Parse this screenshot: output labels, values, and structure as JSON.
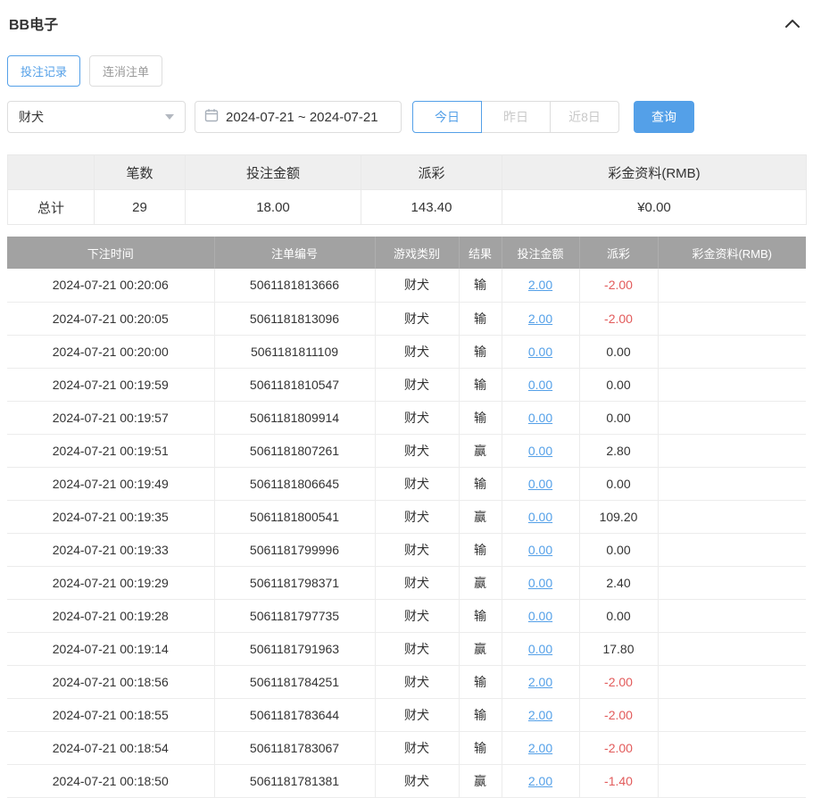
{
  "header": {
    "title": "BB电子",
    "collapse_icon": "chevron-up"
  },
  "tabs": [
    {
      "label": "投注记录",
      "active": true
    },
    {
      "label": "连消注单",
      "active": false
    }
  ],
  "filters": {
    "game_select_value": "财犬",
    "date_range_value": "2024-07-21 ~ 2024-07-21",
    "quick_buttons": [
      {
        "label": "今日",
        "active": true
      },
      {
        "label": "昨日",
        "active": false
      },
      {
        "label": "近8日",
        "active": false
      }
    ],
    "search_label": "查询"
  },
  "summary": {
    "row_label": "总计",
    "columns": [
      "笔数",
      "投注金额",
      "派彩",
      "彩金资料(RMB)"
    ],
    "values": [
      "29",
      "18.00",
      "143.40",
      "¥0.00"
    ]
  },
  "table": {
    "columns": [
      "下注时间",
      "注单编号",
      "游戏类别",
      "结果",
      "投注金额",
      "派彩",
      "彩金资料(RMB)"
    ],
    "rows": [
      {
        "time": "2024-07-21 00:20:06",
        "order_id": "5061181813666",
        "game": "财犬",
        "result": "输",
        "bet": "2.00",
        "payout": "-2.00",
        "bonus": ""
      },
      {
        "time": "2024-07-21 00:20:05",
        "order_id": "5061181813096",
        "game": "财犬",
        "result": "输",
        "bet": "2.00",
        "payout": "-2.00",
        "bonus": ""
      },
      {
        "time": "2024-07-21 00:20:00",
        "order_id": "5061181811109",
        "game": "财犬",
        "result": "输",
        "bet": "0.00",
        "payout": "0.00",
        "bonus": ""
      },
      {
        "time": "2024-07-21 00:19:59",
        "order_id": "5061181810547",
        "game": "财犬",
        "result": "输",
        "bet": "0.00",
        "payout": "0.00",
        "bonus": ""
      },
      {
        "time": "2024-07-21 00:19:57",
        "order_id": "5061181809914",
        "game": "财犬",
        "result": "输",
        "bet": "0.00",
        "payout": "0.00",
        "bonus": ""
      },
      {
        "time": "2024-07-21 00:19:51",
        "order_id": "5061181807261",
        "game": "财犬",
        "result": "赢",
        "bet": "0.00",
        "payout": "2.80",
        "bonus": ""
      },
      {
        "time": "2024-07-21 00:19:49",
        "order_id": "5061181806645",
        "game": "财犬",
        "result": "输",
        "bet": "0.00",
        "payout": "0.00",
        "bonus": ""
      },
      {
        "time": "2024-07-21 00:19:35",
        "order_id": "5061181800541",
        "game": "财犬",
        "result": "赢",
        "bet": "0.00",
        "payout": "109.20",
        "bonus": ""
      },
      {
        "time": "2024-07-21 00:19:33",
        "order_id": "5061181799996",
        "game": "财犬",
        "result": "输",
        "bet": "0.00",
        "payout": "0.00",
        "bonus": ""
      },
      {
        "time": "2024-07-21 00:19:29",
        "order_id": "5061181798371",
        "game": "财犬",
        "result": "赢",
        "bet": "0.00",
        "payout": "2.40",
        "bonus": ""
      },
      {
        "time": "2024-07-21 00:19:28",
        "order_id": "5061181797735",
        "game": "财犬",
        "result": "输",
        "bet": "0.00",
        "payout": "0.00",
        "bonus": ""
      },
      {
        "time": "2024-07-21 00:19:14",
        "order_id": "5061181791963",
        "game": "财犬",
        "result": "赢",
        "bet": "0.00",
        "payout": "17.80",
        "bonus": ""
      },
      {
        "time": "2024-07-21 00:18:56",
        "order_id": "5061181784251",
        "game": "财犬",
        "result": "输",
        "bet": "2.00",
        "payout": "-2.00",
        "bonus": ""
      },
      {
        "time": "2024-07-21 00:18:55",
        "order_id": "5061181783644",
        "game": "财犬",
        "result": "输",
        "bet": "2.00",
        "payout": "-2.00",
        "bonus": ""
      },
      {
        "time": "2024-07-21 00:18:54",
        "order_id": "5061181783067",
        "game": "财犬",
        "result": "输",
        "bet": "2.00",
        "payout": "-2.00",
        "bonus": ""
      },
      {
        "time": "2024-07-21 00:18:50",
        "order_id": "5061181781381",
        "game": "财犬",
        "result": "赢",
        "bet": "2.00",
        "payout": "-1.40",
        "bonus": ""
      }
    ]
  },
  "colors": {
    "accent": "#54a0e8",
    "negative": "#e25b5b",
    "table_header_bg": "#a2a2a2"
  }
}
